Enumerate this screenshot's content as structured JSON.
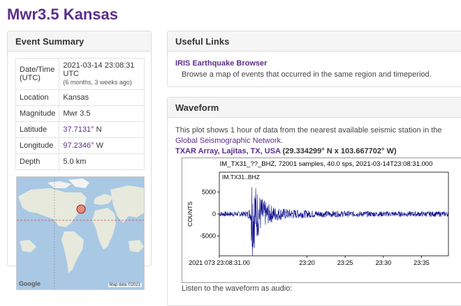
{
  "page": {
    "title": "Mwr3.5 Kansas"
  },
  "event_summary": {
    "heading": "Event Summary",
    "rows": [
      {
        "key": "Date/Time (UTC)",
        "value": "2021-03-14 23:08:31 UTC",
        "sub": "(6 months, 3 weeks ago)"
      },
      {
        "key": "Location",
        "value": "Kansas"
      },
      {
        "key": "Magnitude",
        "value": "Mwr 3.5"
      },
      {
        "key": "Latitude",
        "value": "37.7131°",
        "suffix": " N"
      },
      {
        "key": "Longitude",
        "value": "97.2346°",
        "suffix": " W"
      },
      {
        "key": "Depth",
        "value": "5.0 km"
      }
    ],
    "map": {
      "logo": "Google",
      "credit": "Map data ©2021"
    }
  },
  "useful_links": {
    "heading": "Useful Links",
    "link_label": "IRIS Earthquake Browser",
    "description": "Browse a map of events that occurred in the same region and timeperiod."
  },
  "waveform": {
    "heading": "Waveform",
    "desc_prefix": "This plot shows 1 hour of data from the nearest available seismic station in the ",
    "desc_link": "Global Seismographic Network",
    "desc_suffix": ".",
    "station_link": "TXAR Array, Lajitas, TX, USA",
    "station_coords": " (29.334299° N x 103.667702° W)",
    "audio_label": "Listen to the waveform as audio:",
    "colors": {
      "trace": "#0a0a8c",
      "link": "#5d2e8c"
    }
  },
  "chart_data": {
    "type": "line",
    "title": "IM_TX31_??_BHZ, 72001 samples, 40.0 sps, 2021-03-14T23:08:31.000",
    "legend": "IM.TX31..BHZ",
    "ylabel": "COUNTS",
    "ylim": [
      -9500,
      9500
    ],
    "yticks": [
      5000,
      0,
      -5000
    ],
    "xticks": [
      "2021 073 23:08:31.00",
      "23:20",
      "23:25",
      "23:30",
      "23:35"
    ],
    "x_minutes": [
      0,
      11.48,
      16.48,
      21.48,
      26.48
    ],
    "x_range": [
      0,
      30
    ],
    "event_minute": 4.2,
    "peak_amplitude": 8800,
    "background_amplitude": 600
  }
}
